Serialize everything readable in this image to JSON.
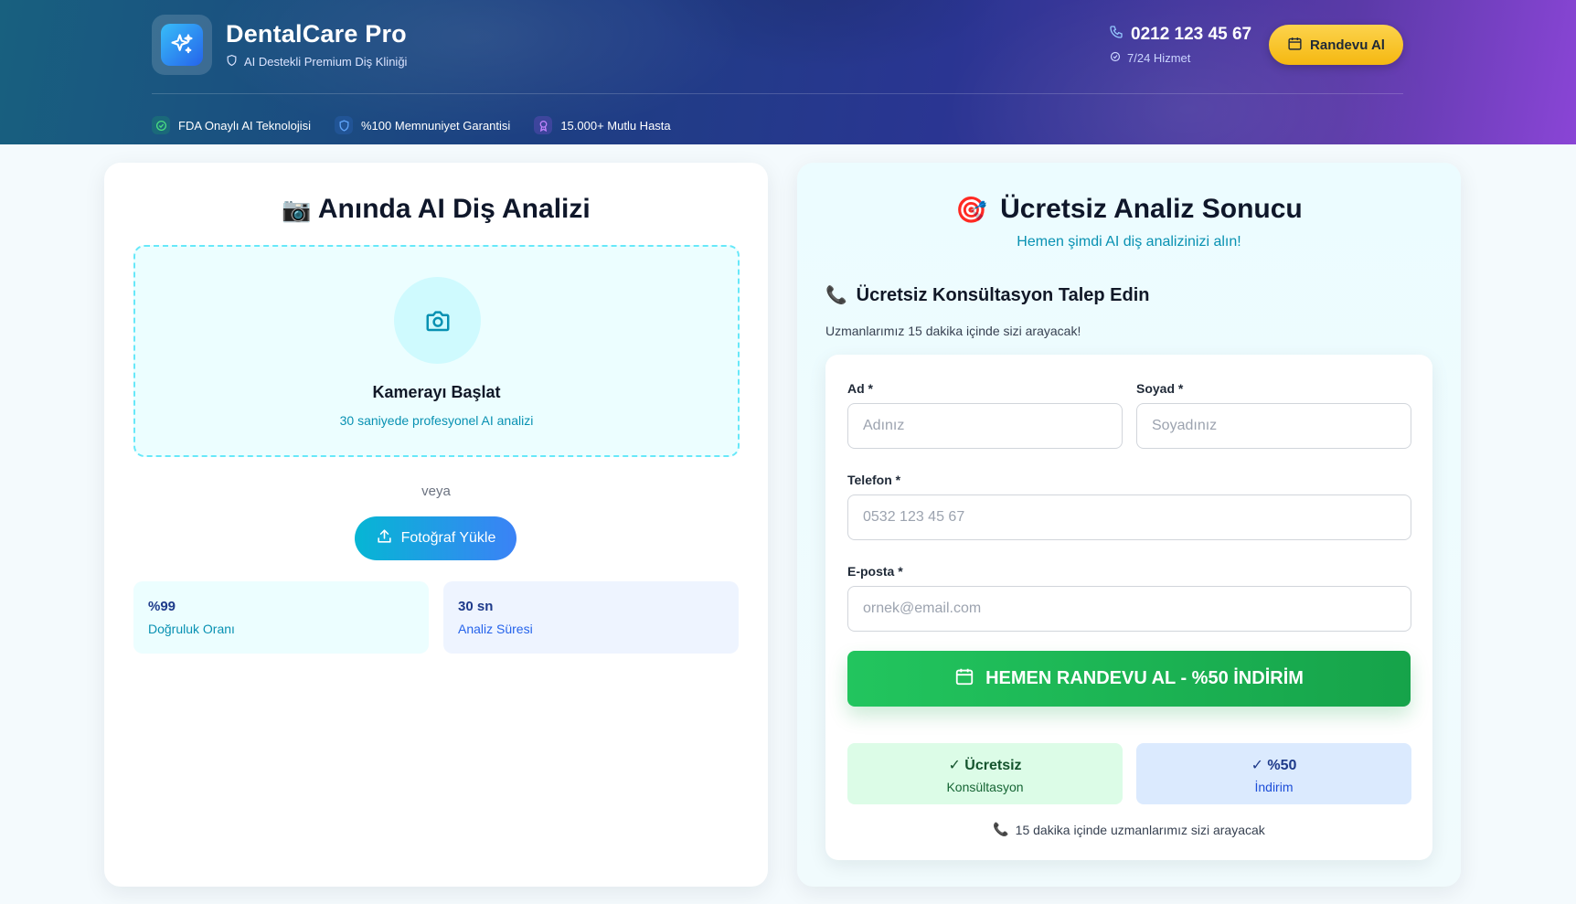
{
  "header": {
    "brand": "DentalCare Pro",
    "tagline": "AI Destekli Premium Diş Kliniği",
    "phone": "0212 123 45 67",
    "service": "7/24 Hizmet",
    "cta_label": "Randevu Al",
    "badges": [
      {
        "label": "FDA Onaylı AI Teknolojisi",
        "icon": "check-circle-icon",
        "color": "#22c55e"
      },
      {
        "label": "%100 Memnuniyet Garantisi",
        "icon": "shield-icon",
        "color": "#3b82f6"
      },
      {
        "label": "15.000+ Mutlu Hasta",
        "icon": "award-icon",
        "color": "#a855f7"
      }
    ]
  },
  "analysis": {
    "emoji": "📷",
    "title": "Anında AI Diş Analizi",
    "camera_title": "Kamerayı Başlat",
    "camera_sub": "30 saniyede profesyonel AI analizi",
    "or": "veya",
    "upload_label": "Fotoğraf Yükle",
    "stats": [
      {
        "value": "%99",
        "label": "Doğruluk Oranı"
      },
      {
        "value": "30 sn",
        "label": "Analiz Süresi"
      }
    ]
  },
  "result": {
    "emoji": "🎯",
    "title": "Ücretsiz Analiz Sonucu",
    "subtitle": "Hemen şimdi AI diş analizinizi alın!",
    "consult_emoji": "📞",
    "consult_title": "Ücretsiz Konsültasyon Talep Edin",
    "consult_sub": "Uzmanlarımız 15 dakika içinde sizi arayacak!",
    "form": {
      "first_name_label": "Ad *",
      "first_name_placeholder": "Adınız",
      "last_name_label": "Soyad *",
      "last_name_placeholder": "Soyadınız",
      "phone_label": "Telefon *",
      "phone_placeholder": "0532 123 45 67",
      "email_label": "E-posta *",
      "email_placeholder": "ornek@email.com",
      "submit_label": "HEMEN RANDEVU AL - %50 İNDİRİM"
    },
    "perks": [
      {
        "title": "✓ Ücretsiz",
        "sub": "Konsültasyon"
      },
      {
        "title": "✓ %50",
        "sub": "İndirim"
      }
    ],
    "call_note": "15 dakika içinde uzmanlarımız sizi arayacak"
  },
  "colors": {
    "accent_cyan": "#06b6d4",
    "cta_yellow": "#fcd34d",
    "success_green": "#22c55e"
  }
}
